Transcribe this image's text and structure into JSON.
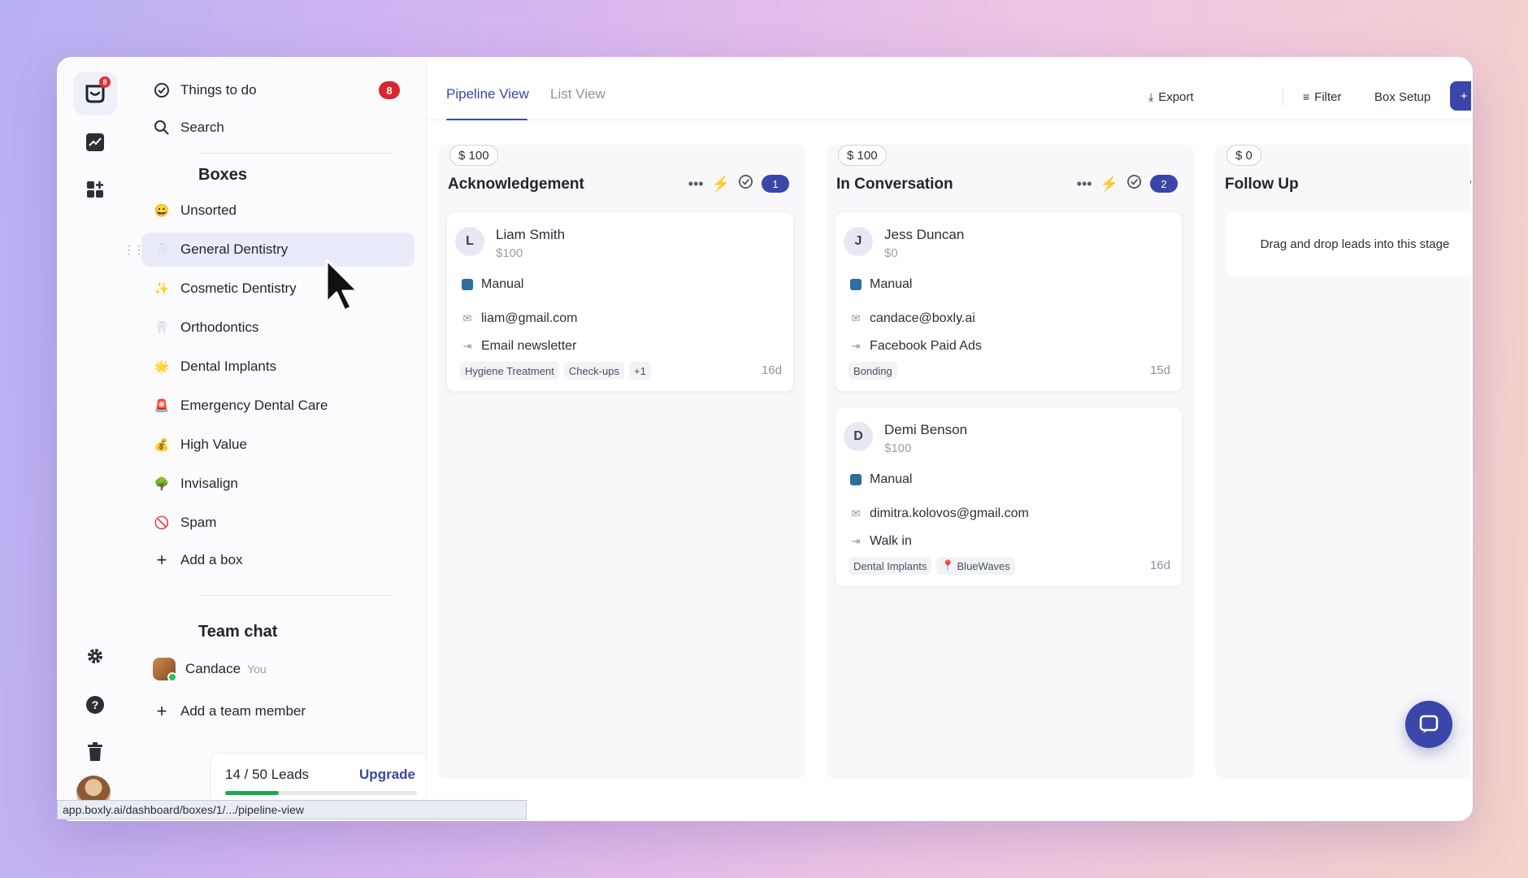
{
  "sidebar": {
    "things_to_do": "Things to do",
    "things_count": "8",
    "search": "Search",
    "boxes_title": "Boxes",
    "boxes": [
      {
        "label": "Unsorted",
        "icon": "smiley-emoji-icon"
      },
      {
        "label": "General Dentistry",
        "icon": "tooth-emoji-icon"
      },
      {
        "label": "Cosmetic Dentistry",
        "icon": "sparkles-emoji-icon"
      },
      {
        "label": "Orthodontics",
        "icon": "tooth-emoji-icon"
      },
      {
        "label": "Dental Implants",
        "icon": "star-emoji-icon"
      },
      {
        "label": "Emergency Dental Care",
        "icon": "alarm-light-emoji-icon"
      },
      {
        "label": "High Value",
        "icon": "money-bag-emoji-icon"
      },
      {
        "label": "Invisalign",
        "icon": "tree-emoji-icon"
      },
      {
        "label": "Spam",
        "icon": "prohibited-emoji-icon"
      }
    ],
    "add_box": "Add a box",
    "team_chat_title": "Team chat",
    "team_member": "Candace",
    "you_label": "You",
    "add_member": "Add a team member",
    "leads_used": "14",
    "leads_total": "50 Leads",
    "leads_text": "14 / 50 Leads",
    "leads_fraction": 0.28,
    "upgrade": "Upgrade"
  },
  "header": {
    "tabs": [
      "Pipeline View",
      "List View"
    ],
    "export": "Export",
    "filter": "Filter",
    "box_setup": "Box Setup",
    "lead": "+ Lead"
  },
  "columns": [
    {
      "amount": "$ 100",
      "title": "Acknowledgement",
      "count": "1",
      "cards": [
        {
          "initial": "L",
          "name": "Liam Smith",
          "amount": "$100",
          "source": "Manual",
          "email": "liam@gmail.com",
          "channel": "Email newsletter",
          "tags": [
            "Hygiene Treatment",
            "Check-ups",
            "+1"
          ],
          "age": "16d"
        }
      ]
    },
    {
      "amount": "$ 100",
      "title": "In Conversation",
      "count": "2",
      "cards": [
        {
          "initial": "J",
          "name": "Jess Duncan",
          "amount": "$0",
          "source": "Manual",
          "email": "candace@boxly.ai",
          "channel": "Facebook Paid Ads",
          "tags": [
            "Bonding"
          ],
          "age": "15d"
        },
        {
          "initial": "D",
          "name": "Demi Benson",
          "amount": "$100",
          "source": "Manual",
          "email": "dimitra.kolovos@gmail.com",
          "channel": "Walk in",
          "tags": [
            "Dental Implants",
            "BlueWaves"
          ],
          "age": "16d"
        }
      ]
    },
    {
      "amount": "$ 0",
      "title": "Follow Up",
      "empty_text": "Drag and drop leads into this stage"
    }
  ],
  "status_url": "app.boxly.ai/dashboard/boxes/1/.../pipeline-view",
  "colors": {
    "accent": "#3a46a8",
    "badge_red": "#d9252f",
    "progress_green": "#1ea84e",
    "bolt_yellow": "#f2b21a"
  }
}
